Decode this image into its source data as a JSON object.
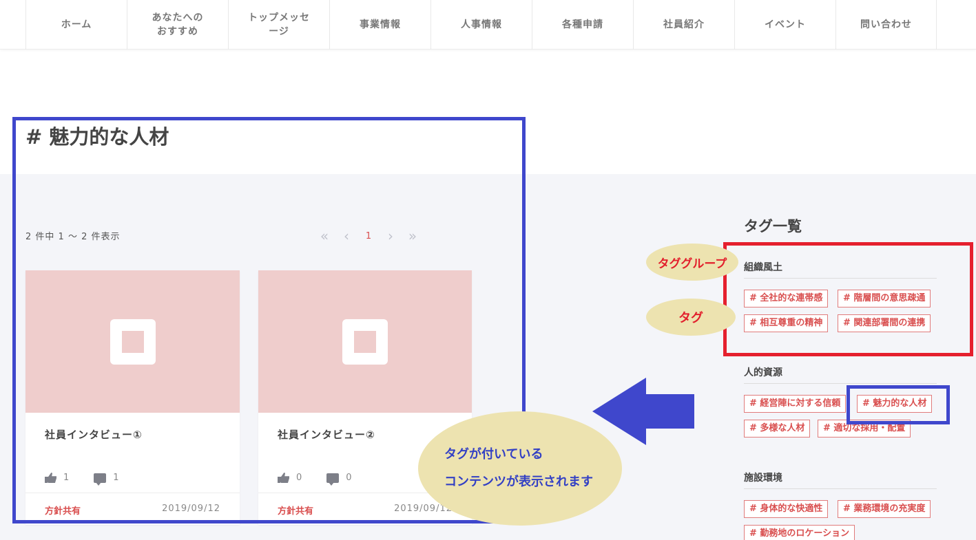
{
  "nav": {
    "items": [
      {
        "label": "ホーム"
      },
      {
        "label": "あなたへの\nおすすめ"
      },
      {
        "label": "トップメッセ\nージ"
      },
      {
        "label": "事業情報"
      },
      {
        "label": "人事情報"
      },
      {
        "label": "各種申請"
      },
      {
        "label": "社員紹介"
      },
      {
        "label": "イベント"
      },
      {
        "label": "問い合わせ"
      }
    ]
  },
  "page": {
    "title": "# 魅力的な人材",
    "result_count": "2 件中 1 ～ 2 件表示"
  },
  "pager": {
    "first": "«",
    "prev": "‹",
    "current": "1",
    "next": "›",
    "last": "»"
  },
  "cards": [
    {
      "title": "社員インタビュー①",
      "likes": "1",
      "comments": "1",
      "category": "方針共有",
      "date": "2019/09/12"
    },
    {
      "title": "社員インタビュー②",
      "likes": "0",
      "comments": "0",
      "category": "方針共有",
      "date": "2019/09/12"
    }
  ],
  "sidebar": {
    "title": "タグ一覧",
    "groups": [
      {
        "name": "組織風土",
        "tags": [
          "# 全社的な連帯感",
          "# 階層間の意思疎通",
          "# 相互尊重の精神",
          "# 関連部署間の連携"
        ]
      },
      {
        "name": "人的資源",
        "tags": [
          "# 経営陣に対する信頼",
          "# 魅力的な人材",
          "# 多様な人材",
          "# 適切な採用・配置"
        ]
      },
      {
        "name": "施設環境",
        "tags": [
          "# 身体的な快適性",
          "# 業務環境の充実度",
          "# 勤務地のロケーション"
        ]
      }
    ]
  },
  "annotations": {
    "tag_group": "タググループ",
    "tag": "タグ",
    "content_line1": "タグが付いている",
    "content_line2": "コンテンツが表示されます",
    "colors": {
      "blue": "#3f47cc",
      "red": "#e5202e",
      "ellipse": "#ede3b0"
    }
  }
}
